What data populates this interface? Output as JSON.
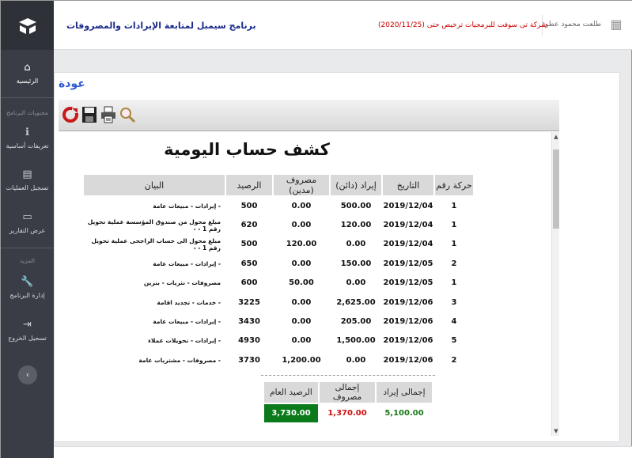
{
  "header": {
    "user_name": "طلعت محمود عطوة",
    "company": "شركة تى سوفت للبرمجيات ترخيص حتى (2020/11/25)",
    "program_title": "برنامج سيمبل لمتابعة الإيرادات والمصروفات"
  },
  "sidebar": {
    "items": [
      {
        "label": "الرئيسية",
        "icon": "home-icon"
      },
      {
        "label": "تعريفات أساسية",
        "icon": "info-icon"
      },
      {
        "label": "تسجيل العمليات",
        "icon": "document-icon"
      },
      {
        "label": "عرض التقارير",
        "icon": "report-icon"
      },
      {
        "label": "إدارة البرنامج",
        "icon": "wrench-icon"
      },
      {
        "label": "تسجيل الخروج",
        "icon": "logout-icon"
      }
    ],
    "sections": [
      "محتويات البرنامج",
      "المزيد"
    ],
    "collapse_icon": "chevron-left-icon"
  },
  "panel": {
    "back_label": "عودة",
    "toolbar_icons": [
      "refresh-icon",
      "save-icon",
      "print-icon",
      "search-icon"
    ]
  },
  "report": {
    "title": "كشف حساب اليومية",
    "columns": [
      "حركة رقم",
      "التاريخ",
      "إيراد (دائن)",
      "مصروف (مدين)",
      "الرصيد",
      "البيان"
    ],
    "rows": [
      {
        "no": "1",
        "date": "2019/12/04",
        "credit": "500.00",
        "debit": "0.00",
        "balance": "500",
        "desc": "- إيرادات - مبيعات عامة"
      },
      {
        "no": "1",
        "date": "2019/12/04",
        "credit": "120.00",
        "debit": "0.00",
        "balance": "620",
        "desc": "مبلغ محول من صندوق المؤسسة عملية تحويل رقم 1 - -"
      },
      {
        "no": "1",
        "date": "2019/12/04",
        "credit": "0.00",
        "debit": "120.00",
        "balance": "500",
        "desc": "مبلغ محول الى حساب الراجحى عملية تحويل رقم 1 - -"
      },
      {
        "no": "2",
        "date": "2019/12/05",
        "credit": "150.00",
        "debit": "0.00",
        "balance": "650",
        "desc": "- إيرادات - مبيعات عامة"
      },
      {
        "no": "1",
        "date": "2019/12/05",
        "credit": "0.00",
        "debit": "50.00",
        "balance": "600",
        "desc": "مصروفات - نثريات - بنزين"
      },
      {
        "no": "3",
        "date": "2019/12/06",
        "credit": "2,625.00",
        "debit": "0.00",
        "balance": "3225",
        "desc": "- خدمات - تجديد اقامة"
      },
      {
        "no": "4",
        "date": "2019/12/06",
        "credit": "205.00",
        "debit": "0.00",
        "balance": "3430",
        "desc": "- إيرادات - مبيعات عامة"
      },
      {
        "no": "5",
        "date": "2019/12/06",
        "credit": "1,500.00",
        "debit": "0.00",
        "balance": "4930",
        "desc": "- إيرادات - تحويلات عملاء"
      },
      {
        "no": "2",
        "date": "2019/12/06",
        "credit": "0.00",
        "debit": "1,200.00",
        "balance": "3730",
        "desc": "- مصروفات - مشتريات عامة"
      }
    ],
    "totals": {
      "labels": [
        "إجمالى إيراد",
        "إجمالى مصروف",
        "الرصيد العام"
      ],
      "income": "5,100.00",
      "expense": "1,370.00",
      "balance": "3,730.00"
    }
  },
  "colors": {
    "sidebar": "#3a3d45",
    "credit": "#1a7a1a",
    "debit": "#d01010",
    "title_blue": "#1a2a8a",
    "back_blue": "#2f5bd0"
  }
}
